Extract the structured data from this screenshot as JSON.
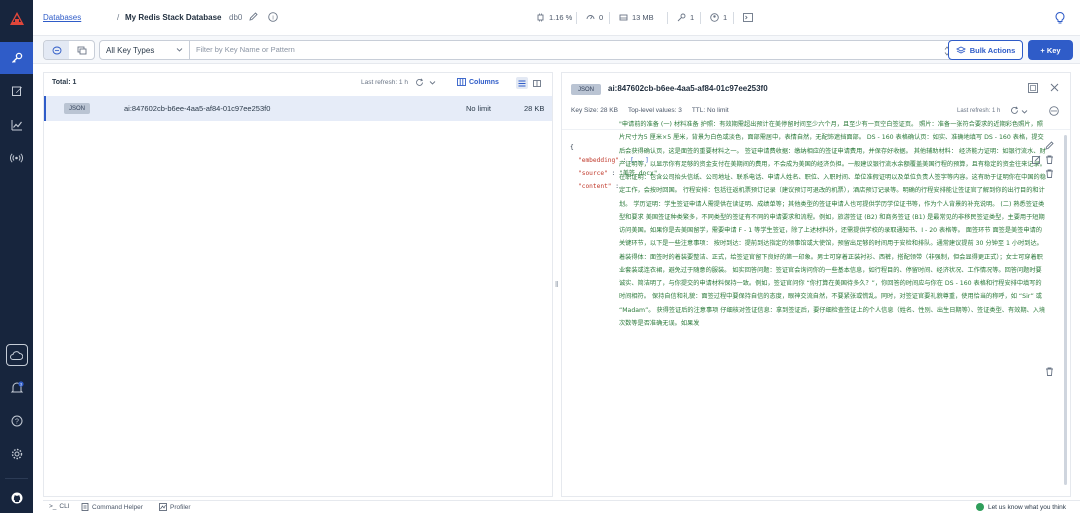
{
  "breadcrumb": {
    "databases": "Databases",
    "separator": "/",
    "database_name": "My Redis Stack Database",
    "db_index": "db0"
  },
  "metrics": {
    "cpu": "1.16 %",
    "ops": "0",
    "memory": "13 MB",
    "keys": "1",
    "clients": "1"
  },
  "toolbar": {
    "key_type": "All Key Types",
    "filter_placeholder": "Filter by Key Name or Pattern",
    "bulk_actions": "Bulk Actions",
    "add_key": "+ Key"
  },
  "list": {
    "total": "Total: 1",
    "last_refresh": "Last refresh: 1 h",
    "columns": "Columns",
    "rows": [
      {
        "type": "JSON",
        "key": "ai:847602cb-b6ee-4aa5-af84-01c97ee253f0",
        "ttl": "No limit",
        "size": "28 KB"
      }
    ]
  },
  "detail": {
    "type": "JSON",
    "key": "ai:847602cb-b6ee-4aa5-af84-01c97ee253f0",
    "key_size": "Key Size: 28 KB",
    "top_level": "Top-level values: 3",
    "ttl": "TTL:  No limit",
    "last_refresh": "Last refresh: 1 h",
    "open_brace": "{",
    "embedding_key": "\"embedding\"",
    "embedding_val": "[...]",
    "source_key": "\"source\"",
    "source_val": "\"美签.docx\"",
    "content_key": "\"content\"",
    "content_val": "\"申请前的准备  (一) 材料准备  护照：有效期需超出预计在美停留时间至少六个月，且至少有一页空白签证页。  照片：准备一张符合要求的近期彩色照片，照片尺寸为5 厘米×5 厘米，背景为白色或淡色，面部需居中，表情自然，无配饰遮挡面部。  DS - 160 表格确认页：如实、准确地填写 DS - 160 表格，提交后会获得确认页，这是面签的重要材料之一。  签证申请费收据：缴纳相应的签证申请费用，并保存好收据。  其他辅助材料：  经济能力证明：如银行流水、财产证明等，以显示你有足够的资金支付在美期间的费用，不会成为美国的经济负担。一般建议银行流水余额覆盖美国行程的预算，且有稳定的资金往来记录。  在职证明：包含公司抬头信纸、公司地址、联系电话、申请人姓名、职位、入职时间、单位准假证明以及单位负责人签字等内容。这有助于证明你在中国的稳定工作，会按时回国。  行程安排：包括往返机票预订记录（建议预订可退改的机票），酒店预订记录等。明确的行程安排能让签证官了解到你的出行目的和计划。  学历证明：学生签证申请人需提供在读证明、成绩单等；其他类型的签证申请人也可提供学历学位证书等，作为个人背景的补充说明。  (二) 熟悉签证类型和要求  美国签证种类繁多，不同类型的签证有不同的申请要求和流程。例如，旅游签证 (B2) 和商务签证 (B1) 是最常见的非移民签证类型，主要用于短期访问美国。如果你是去美国留学，需要申请 F - 1 等学生签证，除了上述材料外，还需提供学校的录取通知书、I - 20 表格等。  面签环节  面签是美签申请的关键环节，以下是一些注意事项：  按时到达：提前到达指定的领事馆或大使馆，预留出足够的时间用于安检和排队。通常建议提前 30 分钟至 1 小时到达。  着装得体：面签时的着装要整洁、正式，给签证官留下良好的第一印象。男士可穿着正装衬衫、西裤，搭配领带（非强制，但会显得更正式）；女士可穿着职业套装或连衣裙，避免过于随意的服装。  如实回答问题：签证官会询问你的一些基本信息，如行程目的、停留时间、经济状况、工作情况等。回答问题时要诚实、简洁明了，与你提交的申请材料保持一致。例如，签证官问你 “你打算在美国待多久？”，你回答的时间应与你在 DS - 160 表格和行程安排中填写的时间相符。  保持自信和礼貌：面签过程中要保持自信的态度，眼神交流自然，不要紧张或慌乱。同时，对签证官要礼貌尊重，使用恰当的称呼，如 “Sir” 或 “Madam”。  获得签证后的注意事项  仔细核对签证信息：拿到签证后，要仔细检查签证上的个人信息（姓名、性别、出生日期等）、签证类型、有效期、入境次数等是否准确无误。如果发"
  },
  "bottom": {
    "cli": "CLI",
    "command_helper": "Command Helper",
    "profiler": "Profiler",
    "feedback": "Let us know what you think"
  }
}
